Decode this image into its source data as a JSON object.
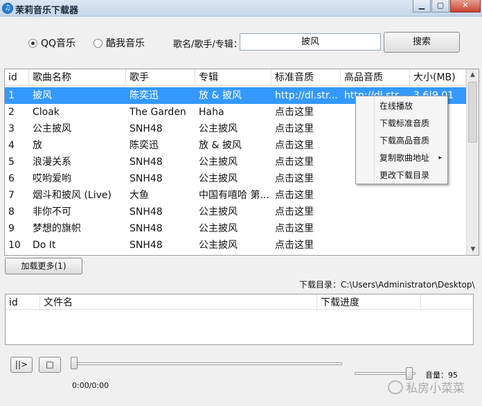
{
  "window": {
    "title": "茉莉音乐下载器",
    "minimize_icon": "minimize-icon",
    "maximize_icon": "maximize-icon",
    "close_icon": "close-icon"
  },
  "search": {
    "sources": [
      {
        "label": "QQ音乐",
        "selected": true
      },
      {
        "label": "酷我音乐",
        "selected": false
      }
    ],
    "field_label": "歌名/歌手/专辑：",
    "query": "披风",
    "button_label": "搜索"
  },
  "results": {
    "columns": [
      "id",
      "歌曲名称",
      "歌手",
      "专辑",
      "标准音质",
      "高品音质",
      "大小(MB)"
    ],
    "rows": [
      [
        "1",
        "披风",
        "陈奕迅",
        "放 & 披风",
        "http://dl.str...",
        "http://dl.str...",
        "3.6|9.01"
      ],
      [
        "2",
        "Cloak",
        "The Garden",
        "Haha",
        "点击这里",
        "",
        ""
      ],
      [
        "3",
        "公主披风",
        "SNH48",
        "公主披风",
        "点击这里",
        "",
        ""
      ],
      [
        "4",
        "放",
        "陈奕迅",
        "放 & 披风",
        "点击这里",
        "",
        ""
      ],
      [
        "5",
        "浪漫关系",
        "SNH48",
        "公主披风",
        "点击这里",
        "",
        ""
      ],
      [
        "6",
        "哎哟爱哟",
        "SNH48",
        "公主披风",
        "点击这里",
        "",
        ""
      ],
      [
        "7",
        "烟斗和披风 (Live)",
        "大鱼",
        "中国有嘻哈 第...",
        "点击这里",
        "",
        ""
      ],
      [
        "8",
        "非你不可",
        "SNH48",
        "公主披风",
        "点击这里",
        "",
        ""
      ],
      [
        "9",
        "梦想的旗帜",
        "SNH48",
        "公主披风",
        "点击这里",
        "",
        ""
      ],
      [
        "10",
        "Do It",
        "SNH48",
        "公主披风",
        "点击这里",
        "",
        ""
      ]
    ],
    "selected_row": 0
  },
  "context_menu": {
    "items": [
      "在线播放",
      "下载标准音质",
      "下载高品音质",
      "复制歌曲地址",
      "更改下载目录"
    ],
    "submenu_arrow": "▸"
  },
  "load_more_label": "加载更多(1)",
  "download_dir": "下载目录：C:\\Users\\Administrator\\Desktop\\",
  "downloads": {
    "columns": [
      "id",
      "文件名",
      "下载进度",
      ""
    ]
  },
  "player": {
    "play_pause_glyph": "||>",
    "stop_glyph": "□",
    "time": "0:00/0:00",
    "volume_label": "音量：95",
    "volume": 95,
    "progress": 0
  },
  "watermark": "私房小菜菜"
}
